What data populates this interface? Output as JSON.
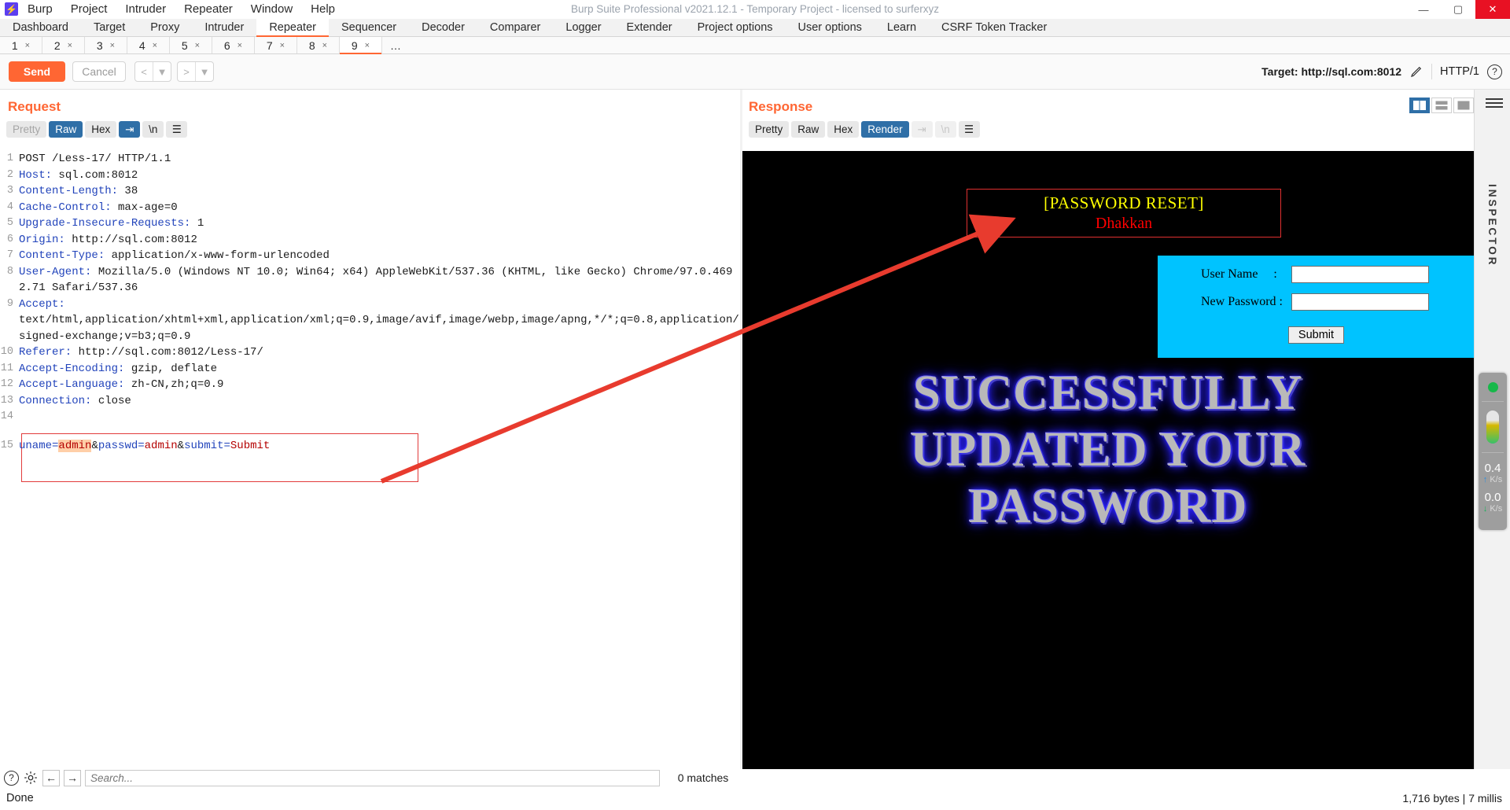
{
  "window": {
    "title": "Burp Suite Professional v2021.12.1 - Temporary Project - licensed to surferxyz",
    "logo_glyph": "⚡",
    "minimize": "—",
    "maximize": "▢",
    "close": "✕"
  },
  "menu": [
    "Burp",
    "Project",
    "Intruder",
    "Repeater",
    "Window",
    "Help"
  ],
  "main_tabs": [
    {
      "label": "Dashboard",
      "active": false
    },
    {
      "label": "Target",
      "active": false
    },
    {
      "label": "Proxy",
      "active": false
    },
    {
      "label": "Intruder",
      "active": false
    },
    {
      "label": "Repeater",
      "active": true
    },
    {
      "label": "Sequencer",
      "active": false
    },
    {
      "label": "Decoder",
      "active": false
    },
    {
      "label": "Comparer",
      "active": false
    },
    {
      "label": "Logger",
      "active": false
    },
    {
      "label": "Extender",
      "active": false
    },
    {
      "label": "Project options",
      "active": false
    },
    {
      "label": "User options",
      "active": false
    },
    {
      "label": "Learn",
      "active": false
    },
    {
      "label": "CSRF Token Tracker",
      "active": false
    }
  ],
  "repeater_tabs": [
    {
      "label": "1",
      "close": "×",
      "active": false
    },
    {
      "label": "2",
      "close": "×",
      "active": false
    },
    {
      "label": "3",
      "close": "×",
      "active": false
    },
    {
      "label": "4",
      "close": "×",
      "active": false
    },
    {
      "label": "5",
      "close": "×",
      "active": false
    },
    {
      "label": "6",
      "close": "×",
      "active": false
    },
    {
      "label": "7",
      "close": "×",
      "active": false
    },
    {
      "label": "8",
      "close": "×",
      "active": false
    },
    {
      "label": "9",
      "close": "×",
      "active": true
    }
  ],
  "repeater_more": "…",
  "toolbar": {
    "send_label": "Send",
    "cancel_label": "Cancel",
    "back_glyph": "<",
    "forward_glyph": ">",
    "dropdown_glyph": "▼",
    "target_label": "Target: http://sql.com:8012",
    "edit_icon": "pencil-icon",
    "http_version": "HTTP/1",
    "help_glyph": "?"
  },
  "request": {
    "title": "Request",
    "view_tabs": [
      {
        "label": "Pretty",
        "state": "muted"
      },
      {
        "label": "Raw",
        "state": "selected"
      },
      {
        "label": "Hex",
        "state": "normal"
      }
    ],
    "icon_buttons": [
      {
        "name": "wrap-lines-icon",
        "glyph": "⇥",
        "state": "selected"
      },
      {
        "name": "newline-icon",
        "glyph": "\\n",
        "state": "normal"
      },
      {
        "name": "menu-icon",
        "glyph": "☰",
        "state": "normal"
      }
    ],
    "lines": [
      {
        "n": "1",
        "text": "POST /Less-17/ HTTP/1.1",
        "kind": "plain"
      },
      {
        "n": "2",
        "header": "Host:",
        "value": " sql.com:8012"
      },
      {
        "n": "3",
        "header": "Content-Length:",
        "value": " 38"
      },
      {
        "n": "4",
        "header": "Cache-Control:",
        "value": " max-age=0"
      },
      {
        "n": "5",
        "header": "Upgrade-Insecure-Requests:",
        "value": " 1"
      },
      {
        "n": "6",
        "header": "Origin:",
        "value": " http://sql.com:8012"
      },
      {
        "n": "7",
        "header": "Content-Type:",
        "value": " application/x-www-form-urlencoded"
      },
      {
        "n": "8",
        "header": "User-Agent:",
        "value": " Mozilla/5.0 (Windows NT 10.0; Win64; x64) AppleWebKit/537.36 (KHTML, like Gecko) Chrome/97.0.4692.71 Safari/537.36"
      },
      {
        "n": "9",
        "header": "Accept:",
        "value": "\ntext/html,application/xhtml+xml,application/xml;q=0.9,image/avif,image/webp,image/apng,*/*;q=0.8,application/signed-exchange;v=b3;q=0.9"
      },
      {
        "n": "10",
        "header": "Referer:",
        "value": " http://sql.com:8012/Less-17/"
      },
      {
        "n": "11",
        "header": "Accept-Encoding:",
        "value": " gzip, deflate"
      },
      {
        "n": "12",
        "header": "Accept-Language:",
        "value": " zh-CN,zh;q=0.9"
      },
      {
        "n": "13",
        "header": "Connection:",
        "value": " close"
      },
      {
        "n": "14",
        "text": "",
        "kind": "plain"
      }
    ],
    "body_line_number": "15",
    "body_parts": [
      {
        "t": "uname=",
        "c": "blue"
      },
      {
        "t": "admin",
        "c": "highlight"
      },
      {
        "t": "&",
        "c": "plain"
      },
      {
        "t": "passwd=",
        "c": "blue"
      },
      {
        "t": "admin",
        "c": "red"
      },
      {
        "t": "&",
        "c": "plain"
      },
      {
        "t": "submit=",
        "c": "blue"
      },
      {
        "t": "Submit",
        "c": "red"
      }
    ]
  },
  "response": {
    "title": "Response",
    "view_tabs": [
      {
        "label": "Pretty",
        "state": "normal"
      },
      {
        "label": "Raw",
        "state": "normal"
      },
      {
        "label": "Hex",
        "state": "normal"
      },
      {
        "label": "Render",
        "state": "selected"
      }
    ],
    "icon_buttons": [
      {
        "name": "wrap-lines-icon",
        "glyph": "⇥",
        "state": "disabled"
      },
      {
        "name": "newline-icon",
        "glyph": "\\n",
        "state": "disabled"
      },
      {
        "name": "menu-icon",
        "glyph": "☰",
        "state": "normal"
      }
    ],
    "rendered_page": {
      "banner_title": "[PASSWORD RESET]",
      "banner_subtitle": "Dhakkan",
      "form": {
        "username_label": "User Name     :",
        "password_label": "New Password :",
        "username_value": "",
        "password_value": "",
        "submit_label": "Submit"
      },
      "success_lines": [
        "SUCCESSFULLY",
        "UPDATED YOUR",
        "PASSWORD"
      ]
    }
  },
  "layout_buttons": [
    {
      "name": "layout-vertical-split",
      "selected": true
    },
    {
      "name": "layout-horizontal-split",
      "selected": false
    },
    {
      "name": "layout-single-pane",
      "selected": false
    }
  ],
  "inspector": {
    "label": "INSPECTOR",
    "menu_icon": "hamburger-icon"
  },
  "network_monitor": {
    "status_dot_color": "#17b84a",
    "upload_value": "0.4",
    "upload_unit": "K/s",
    "download_value": "0.0",
    "download_unit": "K/s",
    "up_arrow": "↑",
    "down_arrow": "↓"
  },
  "search_bar": {
    "help_glyph": "?",
    "settings_icon": "gear-icon",
    "prev_glyph": "←",
    "next_glyph": "→",
    "placeholder": "Search...",
    "value": "",
    "matches": "0 matches"
  },
  "status": {
    "left": "Done",
    "right": "1,716 bytes | 7 millis"
  },
  "colors": {
    "accent": "#ff6633",
    "selected_blue": "#2f6fa7",
    "annotation_red": "#e83b2e",
    "cyan_form": "#00c3ff"
  }
}
